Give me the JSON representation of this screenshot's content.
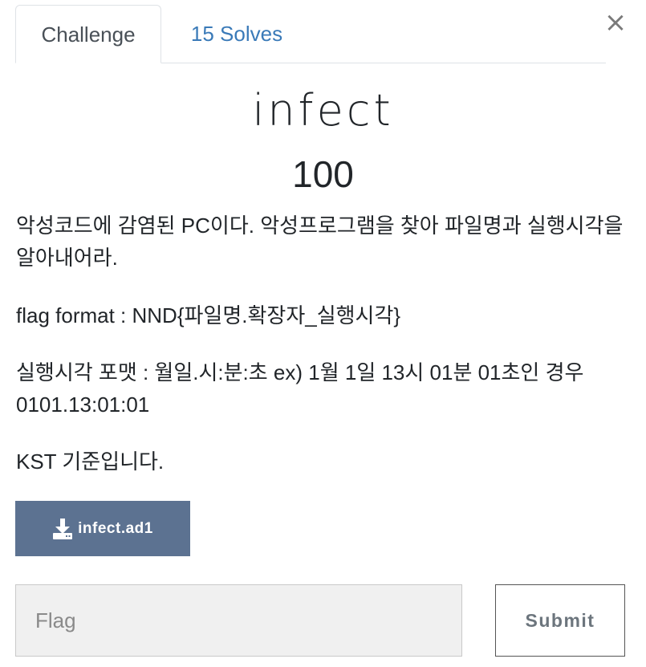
{
  "modal": {
    "close_glyph": "×"
  },
  "tabs": [
    {
      "label": "Challenge",
      "active": true
    },
    {
      "label": "15 Solves",
      "active": false
    }
  ],
  "challenge": {
    "name": "infect",
    "points": "100",
    "description": [
      "악성코드에 감염된 PC이다. 악성프로그램을 찾아 파일명과 실행시각을 알아내어라.",
      "flag format : NND{파일명.확장자_실행시각}",
      "실행시각 포맷 : 월일.시:분:초 ex) 1월 1일 13시 01분 01초인 경우 0101.13:01:01",
      "KST 기준입니다."
    ],
    "file": {
      "icon": "download-icon",
      "label": "infect.ad1"
    }
  },
  "submission": {
    "placeholder": "Flag",
    "value": "",
    "submit_label": "Submit"
  },
  "colors": {
    "accent_link": "#3a7ab8",
    "download_button": "#5c7291",
    "input_background": "#f0f0f0"
  }
}
